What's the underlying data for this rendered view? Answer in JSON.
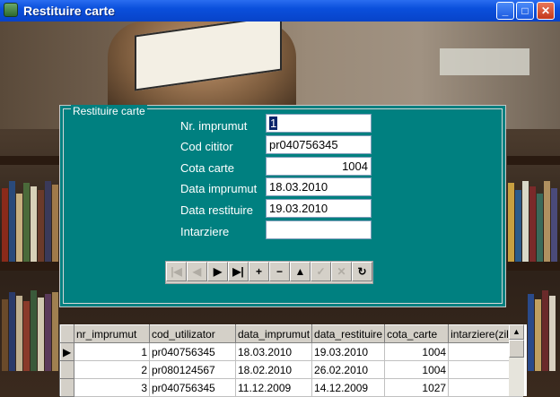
{
  "window": {
    "title": "Restituire carte",
    "icon": "app-icon",
    "controls": [
      "minimize-icon",
      "maximize-icon",
      "close-icon"
    ]
  },
  "form": {
    "group_label": "Restituire carte",
    "fields": [
      {
        "label": "Nr. imprumut",
        "value": "1"
      },
      {
        "label": "Cod cititor",
        "value": "pr040756345"
      },
      {
        "label": "Cota carte",
        "value": "1004"
      },
      {
        "label": "Data imprumut",
        "value": "18.03.2010"
      },
      {
        "label": "Data restituire",
        "value": "19.03.2010"
      },
      {
        "label": "Intarziere",
        "value": ""
      }
    ],
    "navigator": [
      {
        "name": "first-record-icon",
        "glyph": "|◀",
        "enabled": false
      },
      {
        "name": "prior-record-icon",
        "glyph": "◀",
        "enabled": false
      },
      {
        "name": "next-record-icon",
        "glyph": "▶",
        "enabled": true
      },
      {
        "name": "last-record-icon",
        "glyph": "▶|",
        "enabled": true
      },
      {
        "name": "insert-record-icon",
        "glyph": "+",
        "enabled": true
      },
      {
        "name": "delete-record-icon",
        "glyph": "−",
        "enabled": true
      },
      {
        "name": "edit-record-icon",
        "glyph": "▲",
        "enabled": true
      },
      {
        "name": "post-record-icon",
        "glyph": "✓",
        "enabled": false
      },
      {
        "name": "cancel-record-icon",
        "glyph": "✕",
        "enabled": false
      },
      {
        "name": "refresh-record-icon",
        "glyph": "↻",
        "enabled": true
      }
    ]
  },
  "grid": {
    "columns": [
      "nr_imprumut",
      "cod_utilizator",
      "data_imprumut",
      "data_restituire",
      "cota_carte",
      "intarziere(zile)"
    ],
    "rows": [
      [
        "1",
        "pr040756345",
        "18.03.2010",
        "19.03.2010",
        "1004",
        ""
      ],
      [
        "2",
        "pr080124567",
        "18.02.2010",
        "26.02.2010",
        "1004",
        ""
      ],
      [
        "3",
        "pr040756345",
        "11.12.2009",
        "14.12.2009",
        "1027",
        ""
      ]
    ],
    "current_row_indicator": "▶"
  }
}
